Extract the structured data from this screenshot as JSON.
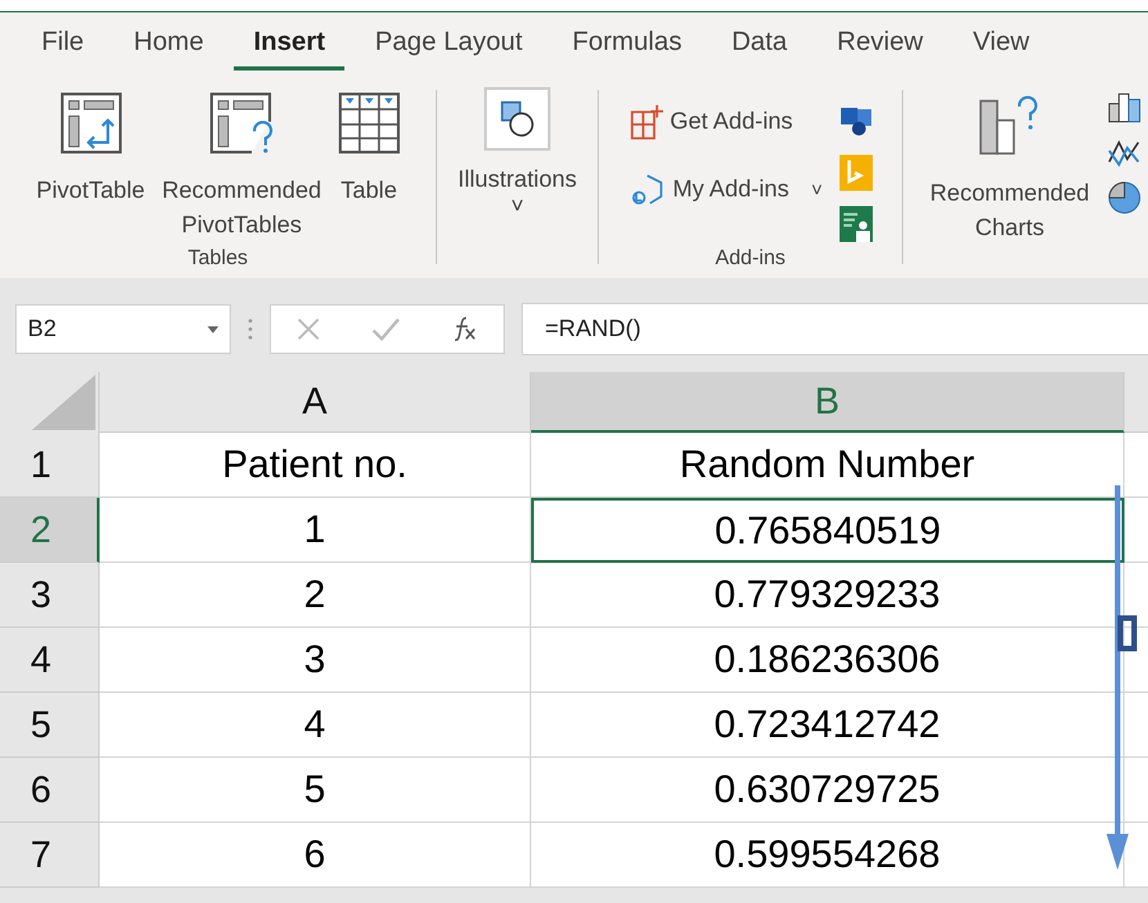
{
  "tabs": [
    {
      "label": "File",
      "selected": false
    },
    {
      "label": "Home",
      "selected": false
    },
    {
      "label": "Insert",
      "selected": true
    },
    {
      "label": "Page Layout",
      "selected": false
    },
    {
      "label": "Formulas",
      "selected": false
    },
    {
      "label": "Data",
      "selected": false
    },
    {
      "label": "Review",
      "selected": false
    },
    {
      "label": "View",
      "selected": false
    }
  ],
  "ribbon": {
    "tables_group": {
      "label": "Tables",
      "buttons": [
        {
          "label": "PivotTable"
        },
        {
          "label": "Recommended PivotTables"
        },
        {
          "label": "Table"
        }
      ]
    },
    "illustrations": {
      "label": "Illustrations",
      "chevron": "˅"
    },
    "addins_group": {
      "label": "Add-ins",
      "get_addins": "Get Add-ins",
      "my_addins": "My Add-ins",
      "chevron": "˅"
    },
    "charts": {
      "recommended": "Recommended Charts"
    }
  },
  "formula_bar": {
    "name_box": "B2",
    "formula": "=RAND()"
  },
  "columns": [
    {
      "label": "A",
      "selected": false
    },
    {
      "label": "B",
      "selected": true
    }
  ],
  "rows": [
    {
      "number": "1",
      "selected": false,
      "cells": [
        {
          "text": "Patient no.",
          "selected": false
        },
        {
          "text": "Random Number",
          "selected": false
        }
      ]
    },
    {
      "number": "2",
      "selected": true,
      "cells": [
        {
          "text": "1",
          "selected": false
        },
        {
          "text": "0.765840519",
          "selected": true
        }
      ]
    },
    {
      "number": "3",
      "selected": false,
      "cells": [
        {
          "text": "2",
          "selected": false
        },
        {
          "text": "0.779329233",
          "selected": false
        }
      ]
    },
    {
      "number": "4",
      "selected": false,
      "cells": [
        {
          "text": "3",
          "selected": false
        },
        {
          "text": "0.186236306",
          "selected": false
        }
      ]
    },
    {
      "number": "5",
      "selected": false,
      "cells": [
        {
          "text": "4",
          "selected": false
        },
        {
          "text": "0.723412742",
          "selected": false
        }
      ]
    },
    {
      "number": "6",
      "selected": false,
      "cells": [
        {
          "text": "5",
          "selected": false
        },
        {
          "text": "0.630729725",
          "selected": false
        }
      ]
    },
    {
      "number": "7",
      "selected": false,
      "cells": [
        {
          "text": "6",
          "selected": false
        },
        {
          "text": "0.599554268",
          "selected": false
        }
      ]
    }
  ]
}
